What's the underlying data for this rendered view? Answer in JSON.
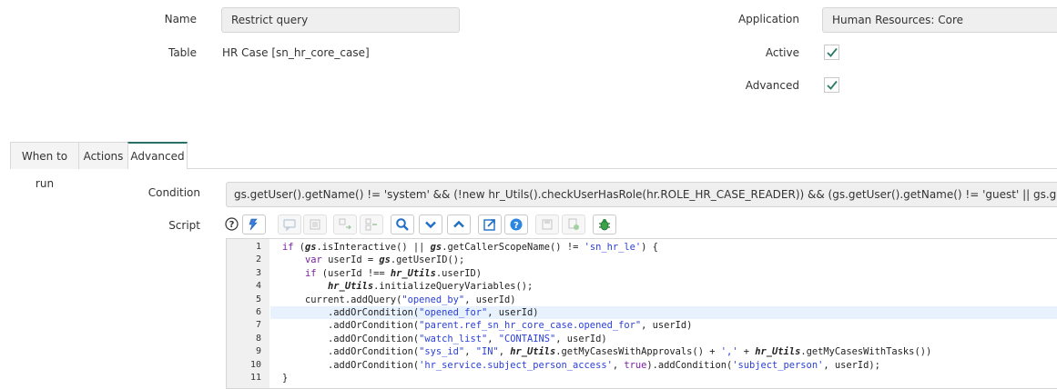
{
  "form": {
    "name_label": "Name",
    "name_value": "Restrict query",
    "table_label": "Table",
    "table_value": "HR Case [sn_hr_core_case]",
    "application_label": "Application",
    "application_value": "Human Resources: Core",
    "active_label": "Active",
    "active_checked": true,
    "advanced_label": "Advanced",
    "advanced_checked": true
  },
  "tabs": [
    {
      "label": "When to run",
      "active": false
    },
    {
      "label": "Actions",
      "active": false
    },
    {
      "label": "Advanced",
      "active": true
    }
  ],
  "advanced": {
    "condition_label": "Condition",
    "condition_value": "gs.getUser().getName() != 'system' && (!new hr_Utils().checkUserHasRole(hr.ROLE_HR_CASE_READER)) && (gs.getUser().getName() != 'guest' || gs.getProperty(\"sn_hr_core.restrict_guest",
    "script_label": "Script",
    "toolbar_icons": [
      "help-icon",
      "format-icon",
      "comment-icon",
      "list-icon",
      "replace-icon",
      "replace-all-icon",
      "search-icon",
      "collapse-icon",
      "expand-icon",
      "fullscreen-icon",
      "info-icon",
      "save-icon",
      "validate-icon",
      "debug-icon"
    ],
    "code_lines": [
      "if (gs.isInteractive() || gs.getCallerScopeName() != 'sn_hr_le') {",
      "    var userId = gs.getUserID();",
      "    if (userId !== hr_Utils.userID)",
      "        hr_Utils.initializeQueryVariables();",
      "    current.addQuery(\"opened_by\", userId)",
      "        .addOrCondition(\"opened_for\", userId)",
      "        .addOrCondition(\"parent.ref_sn_hr_core_case.opened_for\", userId)",
      "        .addOrCondition(\"watch_list\", \"CONTAINS\", userId)",
      "        .addOrCondition(\"sys_id\", \"IN\", hr_Utils.getMyCasesWithApprovals() + ',' + hr_Utils.getMyCasesWithTasks())",
      "        .addOrCondition('hr_service.subject_person_access', true).addCondition('subject_person', userId);",
      "}"
    ],
    "line_numbers": [
      "1",
      "2",
      "3",
      "4",
      "5",
      "6",
      "7",
      "8",
      "9",
      "10",
      "11"
    ],
    "highlighted_line": 6
  },
  "colors": {
    "tab_accent": "#2a6f66",
    "check_green": "#2b7a6c",
    "keyword": "#7a1fa2",
    "string": "#2a3fd6",
    "highlight": "#e8f2fe"
  }
}
